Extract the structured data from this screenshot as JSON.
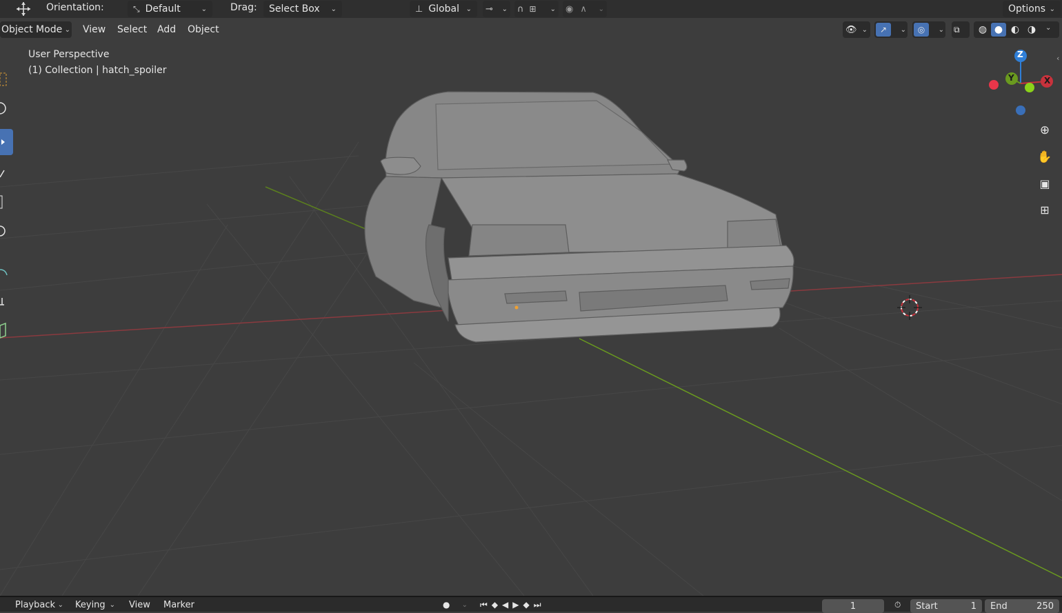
{
  "header": {
    "orientation_label": "Orientation:",
    "orientation_value": "Default",
    "drag_label": "Drag:",
    "drag_value": "Select Box",
    "transform_orientation": "Global",
    "options_label": "Options"
  },
  "menu": {
    "mode": "Object Mode",
    "items": [
      "View",
      "Select",
      "Add",
      "Object"
    ]
  },
  "viewport": {
    "view_name": "User Perspective",
    "collection_info": "(1) Collection | hatch_spoiler",
    "gizmo": {
      "z": "Z",
      "y": "Y",
      "x": "X"
    }
  },
  "timeline": {
    "playback": "Playback",
    "keying": "Keying",
    "view": "View",
    "marker": "Marker",
    "current_frame": "1",
    "start_label": "Start",
    "start_value": "1",
    "end_label": "End",
    "end_value": "250"
  },
  "colors": {
    "x_axis": "#c8323c",
    "y_axis": "#6a9a1f",
    "z_axis": "#2f7fd8",
    "active_tool": "#4772b3",
    "background": "#3d3d3d"
  },
  "icons": {
    "left_tools": [
      "select-box-icon",
      "cursor-icon",
      "move-icon",
      "rotate-icon",
      "scale-icon",
      "transform-icon",
      "annotate-icon",
      "measure-icon",
      "add-cube-icon"
    ],
    "nav": [
      "zoom-icon",
      "hand-icon",
      "camera-icon",
      "grid-icon"
    ]
  }
}
